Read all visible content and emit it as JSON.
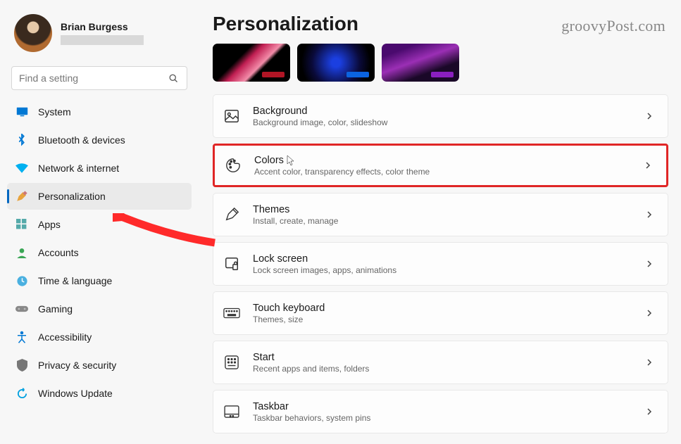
{
  "profile": {
    "name": "Brian Burgess"
  },
  "search": {
    "placeholder": "Find a setting"
  },
  "watermark": "groovyPost.com",
  "sidebar": {
    "items": [
      {
        "label": "System",
        "icon": "system"
      },
      {
        "label": "Bluetooth & devices",
        "icon": "bluetooth"
      },
      {
        "label": "Network & internet",
        "icon": "network"
      },
      {
        "label": "Personalization",
        "icon": "personalization"
      },
      {
        "label": "Apps",
        "icon": "apps"
      },
      {
        "label": "Accounts",
        "icon": "accounts"
      },
      {
        "label": "Time & language",
        "icon": "time"
      },
      {
        "label": "Gaming",
        "icon": "gaming"
      },
      {
        "label": "Accessibility",
        "icon": "accessibility"
      },
      {
        "label": "Privacy & security",
        "icon": "privacy"
      },
      {
        "label": "Windows Update",
        "icon": "update"
      }
    ]
  },
  "page": {
    "title": "Personalization"
  },
  "themes": {
    "swatches": [
      "#b01525",
      "#0b63e0",
      "#8a1fbf"
    ]
  },
  "settings": [
    {
      "title": "Background",
      "sub": "Background image, color, slideshow",
      "icon": "background"
    },
    {
      "title": "Colors",
      "sub": "Accent color, transparency effects, color theme",
      "icon": "colors",
      "highlight": true,
      "cursor": true
    },
    {
      "title": "Themes",
      "sub": "Install, create, manage",
      "icon": "themes"
    },
    {
      "title": "Lock screen",
      "sub": "Lock screen images, apps, animations",
      "icon": "lock"
    },
    {
      "title": "Touch keyboard",
      "sub": "Themes, size",
      "icon": "keyboard"
    },
    {
      "title": "Start",
      "sub": "Recent apps and items, folders",
      "icon": "start"
    },
    {
      "title": "Taskbar",
      "sub": "Taskbar behaviors, system pins",
      "icon": "taskbar"
    }
  ]
}
